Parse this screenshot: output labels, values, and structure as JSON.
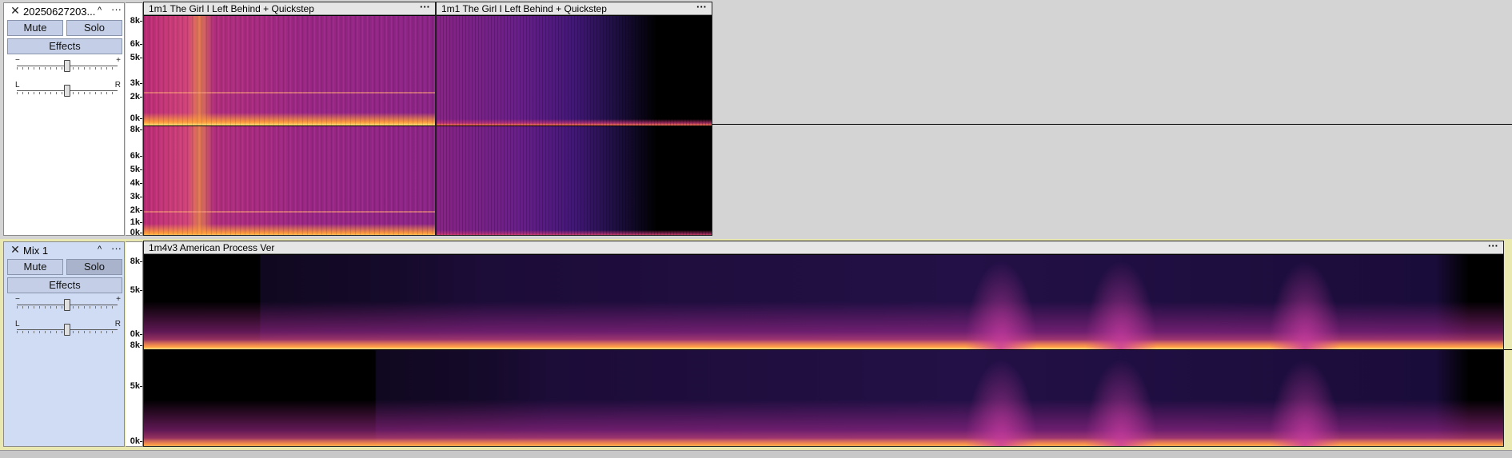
{
  "tracks": [
    {
      "name": "20250627203...",
      "mute_label": "Mute",
      "solo_label": "Solo",
      "effects_label": "Effects",
      "gain_min": "−",
      "gain_plus": "+",
      "pan_left": "L",
      "pan_right": "R",
      "solo_active": false,
      "ruler_top": [
        "8k",
        "6k",
        "5k",
        "3k",
        "2k",
        "0k"
      ],
      "ruler_bottom": [
        "8k",
        "6k",
        "5k",
        "4k",
        "3k",
        "2k",
        "1k",
        "0k"
      ],
      "clips": [
        {
          "title": "1m1 The Girl I Left Behind + Quickstep"
        },
        {
          "title": "1m1 The Girl I Left Behind + Quickstep"
        }
      ]
    },
    {
      "name": "Mix 1",
      "mute_label": "Mute",
      "solo_label": "Solo",
      "effects_label": "Effects",
      "gain_min": "−",
      "gain_plus": "+",
      "pan_left": "L",
      "pan_right": "R",
      "solo_active": true,
      "ruler_top": [
        "8k",
        "5k",
        "0k"
      ],
      "ruler_bottom": [
        "8k",
        "5k",
        "0k"
      ],
      "clips": [
        {
          "title": "1m4v3 American Process Ver"
        }
      ]
    }
  ],
  "colors": {
    "background": "#d4d4d4",
    "selected_track_border": "#e8e8b0",
    "button": "#c4cfe7",
    "spectrogram_hot": "#ffd86a",
    "spectrogram_mid": "#c0287a",
    "spectrogram_low": "#3a1a8a"
  },
  "icons": [
    "close-icon",
    "collapse-caret-icon",
    "track-menu-icon",
    "clip-menu-icon"
  ]
}
